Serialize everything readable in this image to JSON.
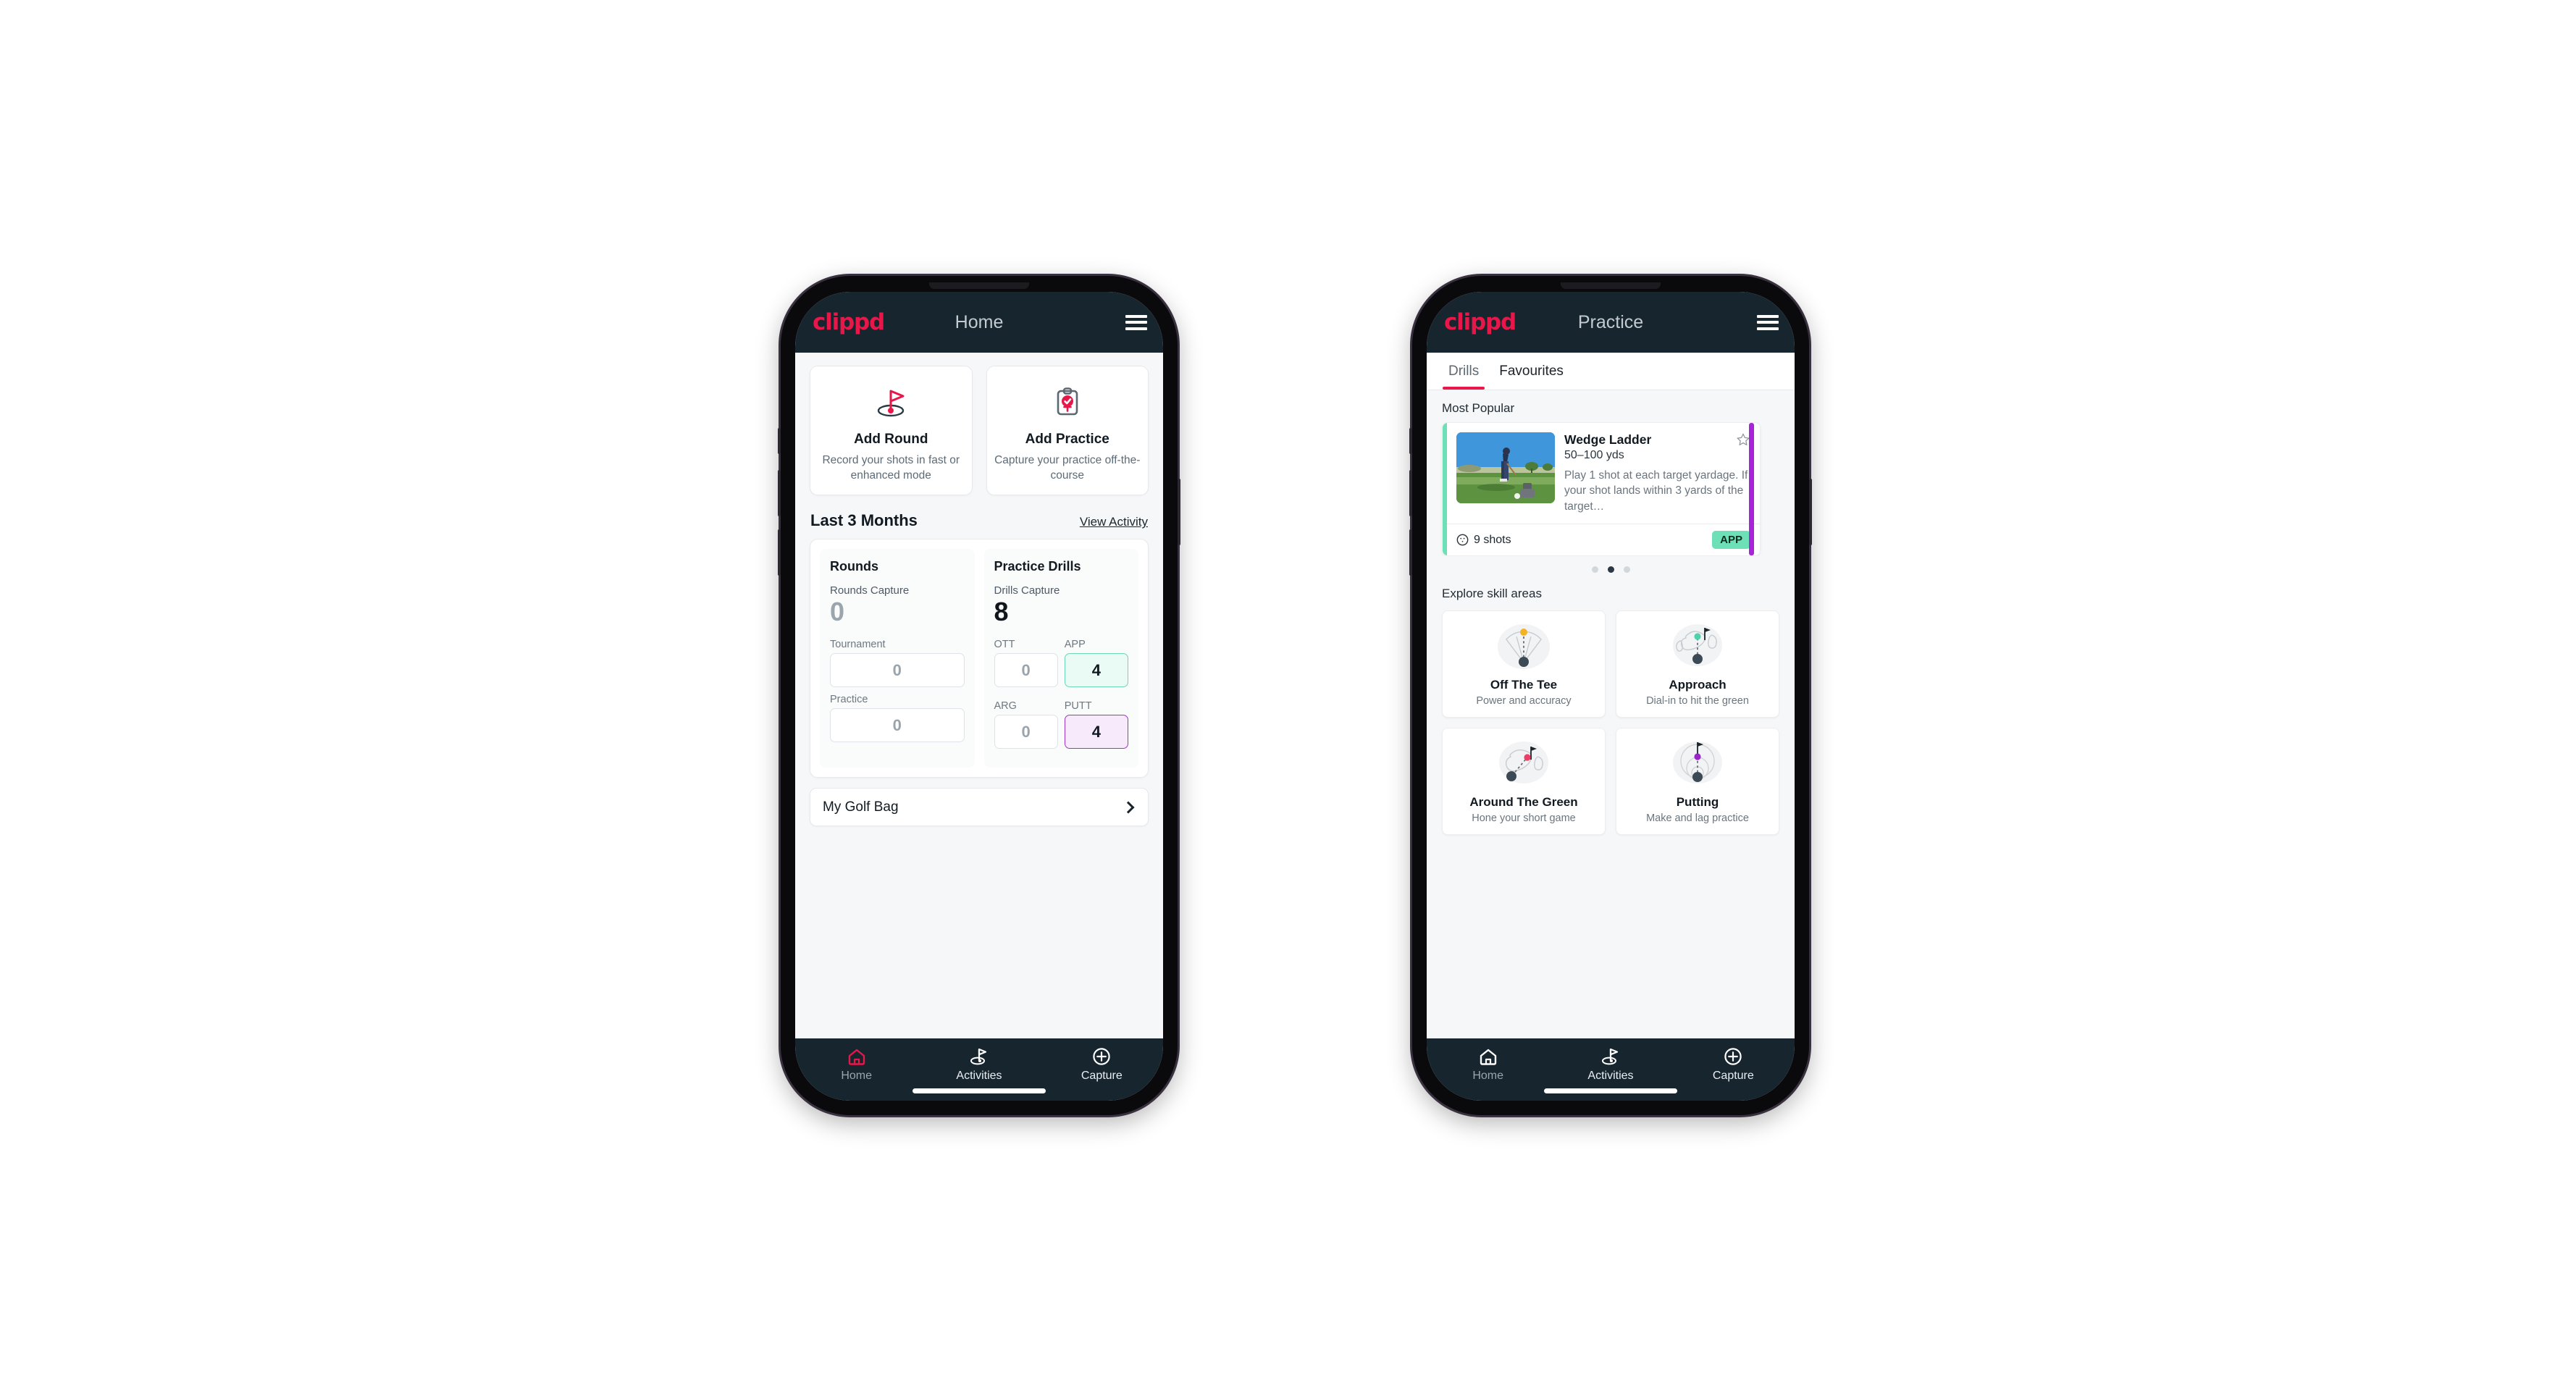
{
  "phones": {
    "left": {
      "appbar": {
        "brand": "clippd",
        "title": "Home",
        "menu_icon": "hamburger-menu-icon"
      },
      "quick_actions": [
        {
          "icon": "golf-flag-icon",
          "title": "Add Round",
          "subtitle": "Record your shots in fast or enhanced mode"
        },
        {
          "icon": "clipboard-check-icon",
          "title": "Add Practice",
          "subtitle": "Capture your practice off-the-course"
        }
      ],
      "section": {
        "title": "Last 3 Months",
        "link": "View Activity"
      },
      "stats": {
        "rounds": {
          "heading": "Rounds",
          "capture_label": "Rounds Capture",
          "capture_value": "0",
          "fields": [
            {
              "label": "Tournament",
              "value": "0",
              "style": "plain"
            },
            {
              "label": "Practice",
              "value": "0",
              "style": "plain"
            }
          ]
        },
        "drills": {
          "heading": "Practice Drills",
          "capture_label": "Drills Capture",
          "capture_value": "8",
          "fields": [
            {
              "label": "OTT",
              "value": "0",
              "style": "plain"
            },
            {
              "label": "APP",
              "value": "4",
              "style": "app"
            },
            {
              "label": "ARG",
              "value": "0",
              "style": "plain"
            },
            {
              "label": "PUTT",
              "value": "4",
              "style": "putt"
            }
          ]
        }
      },
      "golf_bag": {
        "label": "My Golf Bag",
        "chevron_icon": "chevron-right-icon"
      },
      "bottom_nav": [
        {
          "label": "Home",
          "icon": "home-icon",
          "active": true
        },
        {
          "label": "Activities",
          "icon": "golf-flag-icon",
          "active": false
        },
        {
          "label": "Capture",
          "icon": "plus-circle-icon",
          "active": false
        }
      ]
    },
    "right": {
      "appbar": {
        "brand": "clippd",
        "title": "Practice",
        "menu_icon": "hamburger-menu-icon"
      },
      "tabs": [
        {
          "label": "Drills",
          "active": true
        },
        {
          "label": "Favourites",
          "active": false
        }
      ],
      "most_popular_label": "Most Popular",
      "drill_card": {
        "accent_color": "#6ee0b8",
        "thumbnail_icon": "golfer-photo",
        "name": "Wedge Ladder",
        "yardage": "50–100 yds",
        "description": "Play 1 shot at each target yardage. If your shot lands within 3 yards of the target…",
        "favourite_icon": "star-outline-icon",
        "shots_icon": "golf-ball-icon",
        "shots": "9 shots",
        "chip": "APP",
        "chip_color": "#6ee0b8"
      },
      "next_card_accent": "#a724d8",
      "carousel_dots": {
        "count": 3,
        "active_index": 1
      },
      "explore_label": "Explore skill areas",
      "skill_areas": [
        {
          "icon": "tee-shot-fan-icon",
          "name": "Off The Tee",
          "subtitle": "Power and accuracy",
          "dot_color": "#f4b323"
        },
        {
          "icon": "approach-green-icon",
          "name": "Approach",
          "subtitle": "Dial-in to hit the green",
          "dot_color": "#4fd1ac"
        },
        {
          "icon": "around-green-icon",
          "name": "Around The Green",
          "subtitle": "Hone your short game",
          "dot_color": "#ea3f63"
        },
        {
          "icon": "putting-rings-icon",
          "name": "Putting",
          "subtitle": "Make and lag practice",
          "dot_color": "#9b24c9"
        }
      ],
      "bottom_nav": [
        {
          "label": "Home",
          "icon": "home-icon",
          "active": false
        },
        {
          "label": "Activities",
          "icon": "golf-flag-icon",
          "active": false
        },
        {
          "label": "Capture",
          "icon": "plus-circle-icon",
          "active": false
        }
      ]
    }
  },
  "colors": {
    "brand_pink": "#e8174a",
    "appbar_dark": "#17252f",
    "accent_green": "#6ee0b8",
    "accent_purple": "#a724d8"
  }
}
